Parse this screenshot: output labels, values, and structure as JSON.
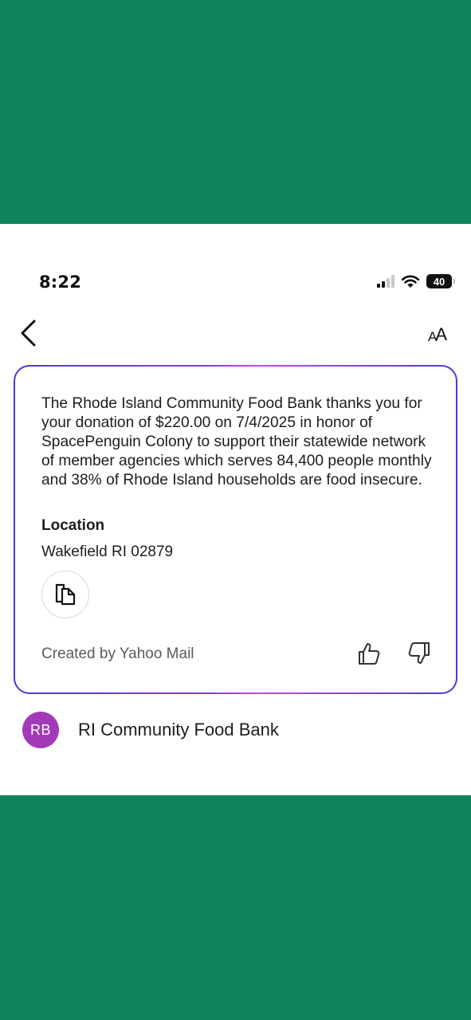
{
  "status_bar": {
    "time": "8:22",
    "battery": "40",
    "signal_icon": "cellular-signal-icon",
    "wifi_icon": "wifi-icon"
  },
  "nav": {
    "back_icon": "chevron-left-icon",
    "text_size_icon": "text-size-icon"
  },
  "card": {
    "body": "The Rhode Island Community Food Bank thanks you for your donation of $220.00 on 7/4/2025 in honor of SpacePenguin Colony to support their statewide network of member agencies which serves 84,400 people monthly and 38% of Rhode Island households are food insecure.",
    "location_label": "Location",
    "location_value": "Wakefield RI 02879",
    "copy_icon": "copy-icon",
    "footer": "Created by Yahoo Mail",
    "thumbs_up_icon": "thumbs-up-icon",
    "thumbs_down_icon": "thumbs-down-icon"
  },
  "sender": {
    "initials": "RB",
    "name": "RI Community Food Bank"
  },
  "colors": {
    "background_band": "#10845d",
    "avatar": "#a23ab8",
    "card_border_start": "#4a3bd1",
    "card_border_mid": "#c04ae0"
  }
}
